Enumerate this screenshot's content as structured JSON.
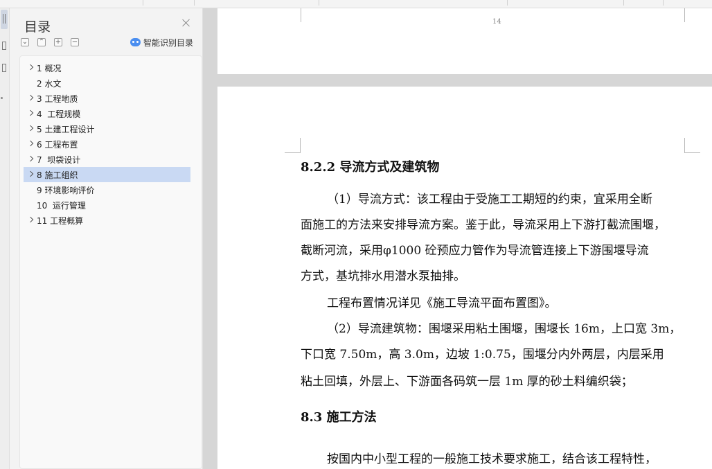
{
  "toc": {
    "title": "目录",
    "smart_label": "智能识别目录",
    "tool_buttons": [
      {
        "icon": "collapse-all-icon",
        "glyph": "⌄"
      },
      {
        "icon": "expand-all-icon",
        "glyph": "⌃"
      },
      {
        "icon": "add-level-icon",
        "glyph": "+"
      },
      {
        "icon": "remove-level-icon",
        "glyph": "−"
      }
    ],
    "items": [
      {
        "label": "1 概况",
        "expandable": true,
        "selected": false
      },
      {
        "label": "2 水文",
        "expandable": false,
        "selected": false
      },
      {
        "label": "3 工程地质",
        "expandable": true,
        "selected": false
      },
      {
        "label": "4  工程规模",
        "expandable": true,
        "selected": false
      },
      {
        "label": "5 土建工程设计",
        "expandable": true,
        "selected": false
      },
      {
        "label": "6 工程布置",
        "expandable": true,
        "selected": false
      },
      {
        "label": "7  坝袋设计",
        "expandable": true,
        "selected": false
      },
      {
        "label": "8 施工组织",
        "expandable": true,
        "selected": true
      },
      {
        "label": "9 环境影响评价",
        "expandable": false,
        "selected": false
      },
      {
        "label": "10  运行管理",
        "expandable": false,
        "selected": false
      },
      {
        "label": "11 工程概算",
        "expandable": true,
        "selected": false
      }
    ],
    "selected_color": "#c9d9f3"
  },
  "document": {
    "page_number": "14",
    "lines": [
      "8.2.2  导流方式及建筑物",
      "（1）导流方式：该工程由于受施工工期短的约束，宜采用全断",
      "面施工的方法来安排导流方案。鉴于此，导流采用上下游打截流围堰，",
      "截断河流，采用φ1000 砼预应力管作为导流管连接上下游围堰导流",
      "方式，基坑排水用潜水泵抽排。",
      "工程布置情况详见《施工导流平面布置图》。",
      "（2）导流建筑物：围堰采用粘土围堰，围堰长 16m，上口宽 3m，",
      "下口宽 7.50m，高 3.0m，边坡 1:0.75，围堰分内外两层，内层采用",
      "粘土回填，外层上、下游面各码筑一层 1m 厚的砂土料编织袋；",
      "8.3  施工方法",
      "按国内中小型工程的一般施工技术要求施工，结合该工程特性，"
    ]
  }
}
